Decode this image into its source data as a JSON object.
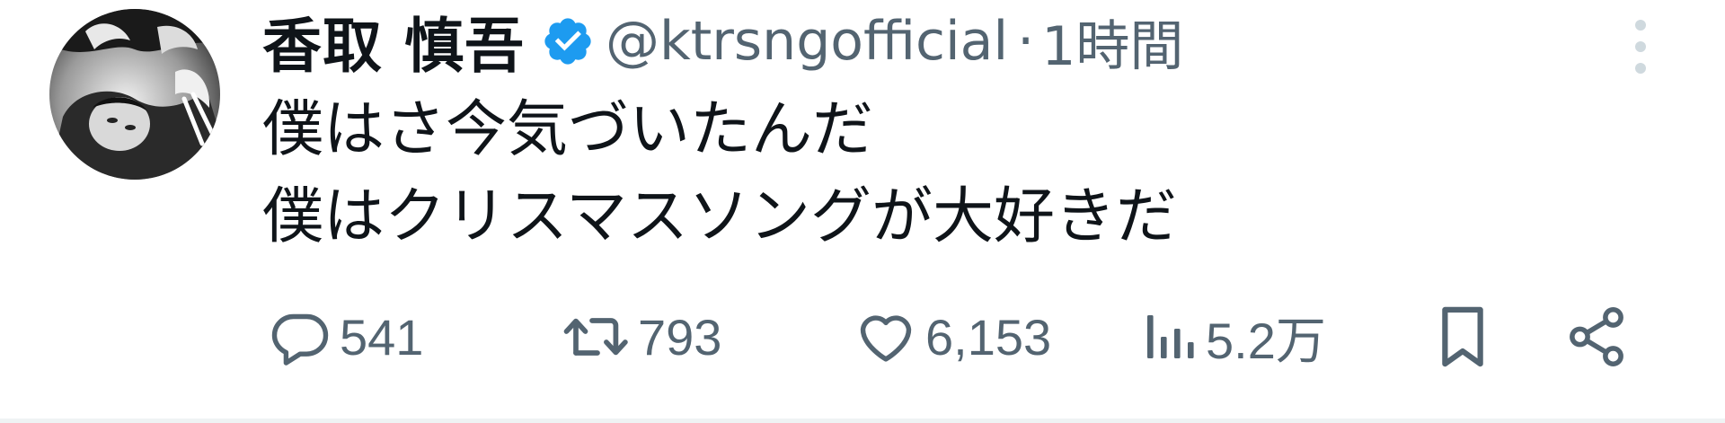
{
  "tweet": {
    "display_name": "香取 慎吾",
    "handle": "@ktrsngofficial",
    "separator": "·",
    "time_ago": "1時間",
    "verified": true,
    "text_lines": [
      "僕はさ今気づいたんだ",
      "僕はクリスマスソングが大好きだ"
    ]
  },
  "actions": {
    "reply_count": "541",
    "retweet_count": "793",
    "like_count": "6,153",
    "views_count": "5.2万"
  },
  "icons": {
    "verified": "verified-badge-icon",
    "more": "more-vertical-icon",
    "reply": "reply-icon",
    "retweet": "retweet-icon",
    "like": "heart-icon",
    "views": "views-chart-icon",
    "bookmark": "bookmark-icon",
    "share": "share-icon"
  },
  "colors": {
    "text_primary": "#0f1419",
    "text_secondary": "#536471",
    "verified_blue": "#1d9bf0",
    "divider": "#eff3f4"
  }
}
